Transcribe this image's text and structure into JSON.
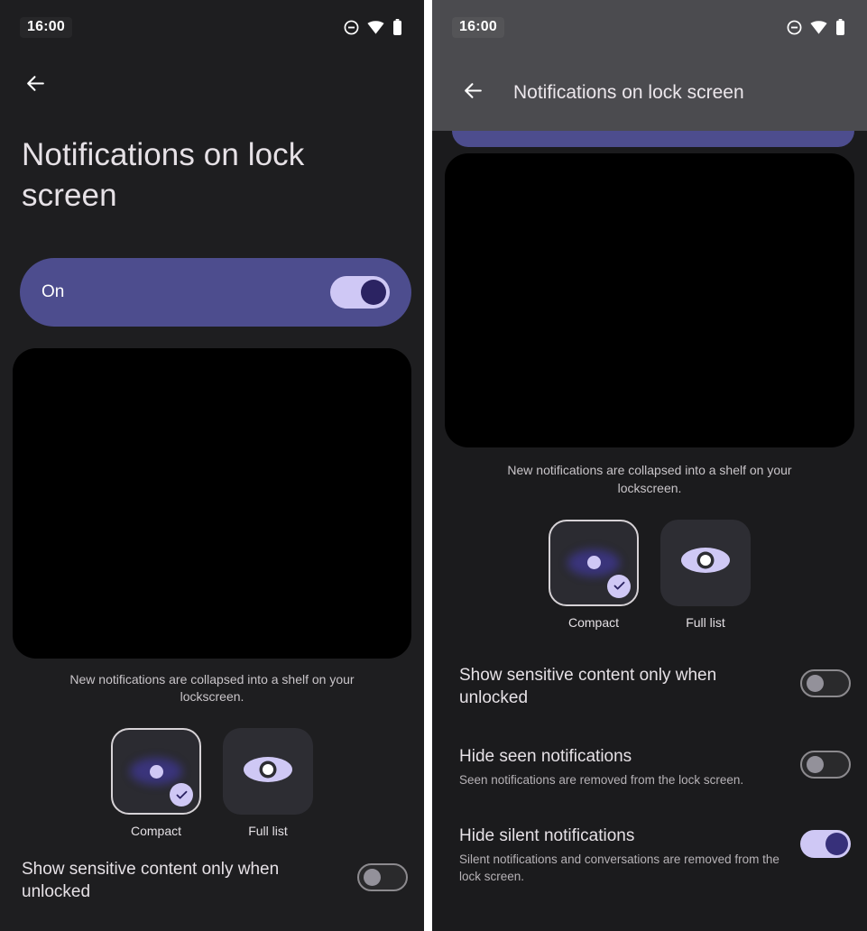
{
  "status_bar": {
    "time": "16:00",
    "icons": [
      "dnd-icon",
      "wifi-icon",
      "battery-icon"
    ]
  },
  "colors": {
    "accent_purple": "#4d4d8e",
    "toggle_on_track": "#cfc8f5",
    "toggle_on_thumb": "#37307a",
    "toggle_off_thumb": "#93919a",
    "background_dark": "#1e1e20",
    "appbar_gray": "#4b4b4f",
    "preview_black": "#000000"
  },
  "left_panel": {
    "back_icon": "arrow-back-icon",
    "title": "Notifications on lock screen",
    "master_toggle": {
      "label": "On",
      "state": "on"
    },
    "helper_text": "New notifications are collapsed into a shelf on your lockscreen.",
    "options": [
      {
        "label": "Compact",
        "icon": "eye-dim-icon",
        "selected": true
      },
      {
        "label": "Full list",
        "icon": "eye-icon",
        "selected": false
      }
    ],
    "cut_off_row": {
      "title": "Show sensitive content only when unlocked",
      "state": "off"
    }
  },
  "right_panel": {
    "back_icon": "arrow-back-icon",
    "appbar_title": "Notifications on lock screen",
    "helper_text": "New notifications are collapsed into a shelf on your lockscreen.",
    "options": [
      {
        "label": "Compact",
        "icon": "eye-dim-icon",
        "selected": true
      },
      {
        "label": "Full list",
        "icon": "eye-icon",
        "selected": false
      }
    ],
    "settings_rows": [
      {
        "title": "Show sensitive content only when unlocked",
        "subtitle": "",
        "state": "off"
      },
      {
        "title": "Hide seen notifications",
        "subtitle": "Seen notifications are removed from the lock screen.",
        "state": "off"
      },
      {
        "title": "Hide silent notifications",
        "subtitle": "Silent notifications and conversations are removed from the lock screen.",
        "state": "on"
      }
    ]
  }
}
